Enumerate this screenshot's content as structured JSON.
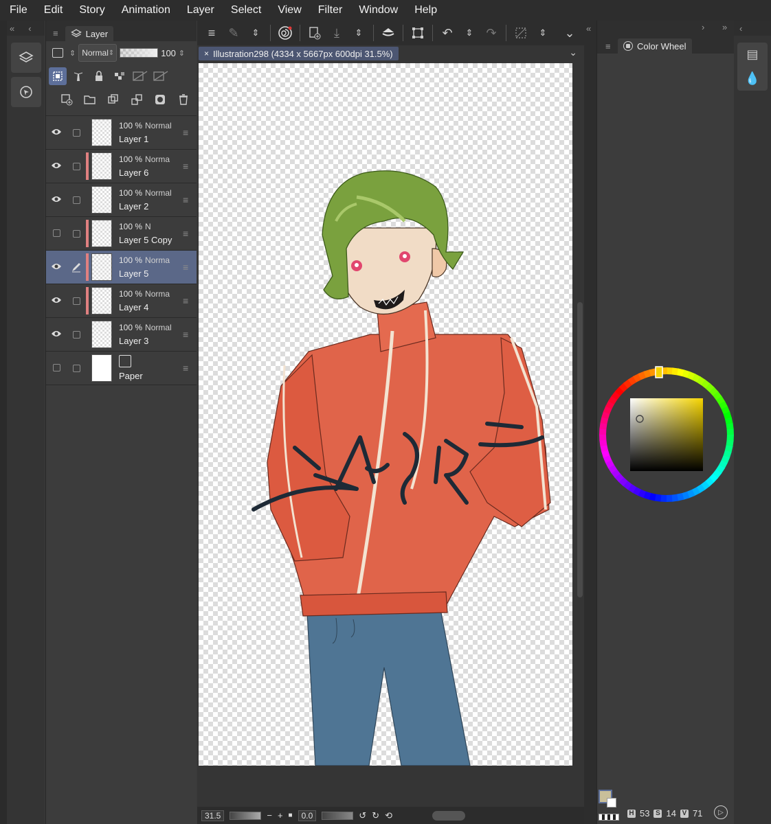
{
  "menu": [
    "File",
    "Edit",
    "Story",
    "Animation",
    "Layer",
    "Select",
    "View",
    "Filter",
    "Window",
    "Help"
  ],
  "layer_panel": {
    "tab_label": "Layer",
    "blend_mode": "Normal",
    "opacity": "100",
    "layers": [
      {
        "opacity": "100 %",
        "mode": "Normal",
        "name": "Layer 1",
        "visible": true,
        "clip": false,
        "selected": false,
        "thumb": "transparent"
      },
      {
        "opacity": "100 %",
        "mode": "Norma",
        "name": "Layer 6",
        "visible": true,
        "clip": true,
        "selected": false,
        "thumb": "transparent"
      },
      {
        "opacity": "100 %",
        "mode": "Normal",
        "name": "Layer 2",
        "visible": true,
        "clip": false,
        "selected": false,
        "thumb": "transparent"
      },
      {
        "opacity": "100 %",
        "mode": "N",
        "name": "Layer 5 Copy",
        "visible": false,
        "clip": true,
        "selected": false,
        "thumb": "transparent"
      },
      {
        "opacity": "100 %",
        "mode": "Norma",
        "name": "Layer 5",
        "visible": true,
        "clip": true,
        "selected": true,
        "thumb": "transparent"
      },
      {
        "opacity": "100 %",
        "mode": "Norma",
        "name": "Layer 4",
        "visible": true,
        "clip": true,
        "selected": false,
        "thumb": "transparent"
      },
      {
        "opacity": "100 %",
        "mode": "Normal",
        "name": "Layer 3",
        "visible": true,
        "clip": false,
        "selected": false,
        "thumb": "transparent"
      },
      {
        "opacity": "",
        "mode": "",
        "name": "Paper",
        "visible": false,
        "clip": false,
        "selected": false,
        "thumb": "white"
      }
    ]
  },
  "document": {
    "tab_title": "Illustration298 (4334 x 5667px 600dpi 31.5%)"
  },
  "status": {
    "zoom": "31.5",
    "rotation": "0.0"
  },
  "color_panel": {
    "tab_label": "Color Wheel",
    "h_label": "H",
    "h_value": "53",
    "s_label": "S",
    "s_value": "14",
    "v_label": "V",
    "v_value": "71"
  },
  "canvas_text": "SALOSIR",
  "colors": {
    "accent": "#5d6f9a",
    "clip_bar": "#e08080",
    "hair": "#7aa13e",
    "jacket": "#e0644a",
    "jeans": "#4f7594",
    "skin": "#f1dcc6",
    "eyes": "#e1466e"
  }
}
